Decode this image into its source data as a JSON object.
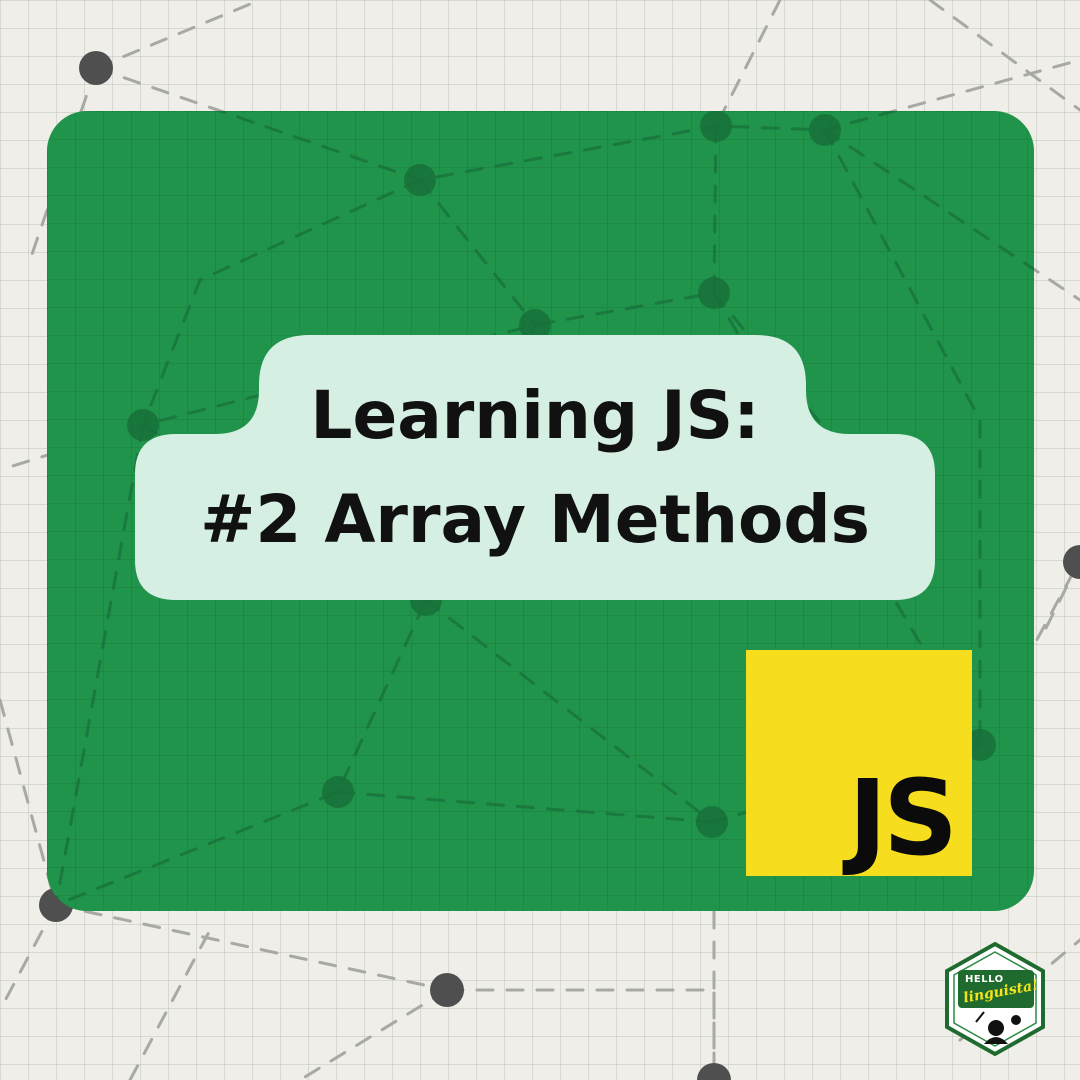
{
  "title": {
    "line1": "Learning JS:",
    "line2": "#2 Array Methods"
  },
  "logo": {
    "text": "JS",
    "background": "#f6dd1e",
    "foreground": "#0b0b0b"
  },
  "brand": {
    "top_text": "HELLO",
    "bottom_text": "linguista!",
    "icon": "hello-linguista-logo-icon"
  },
  "colors": {
    "page_background": "#efeee9",
    "card_green": "#20944a",
    "title_plate": "#d6efe3",
    "title_text": "#111111",
    "network_light": "#a9a9a3",
    "network_dark": "#17703a",
    "brand_dark_green": "#1f6b2f"
  }
}
